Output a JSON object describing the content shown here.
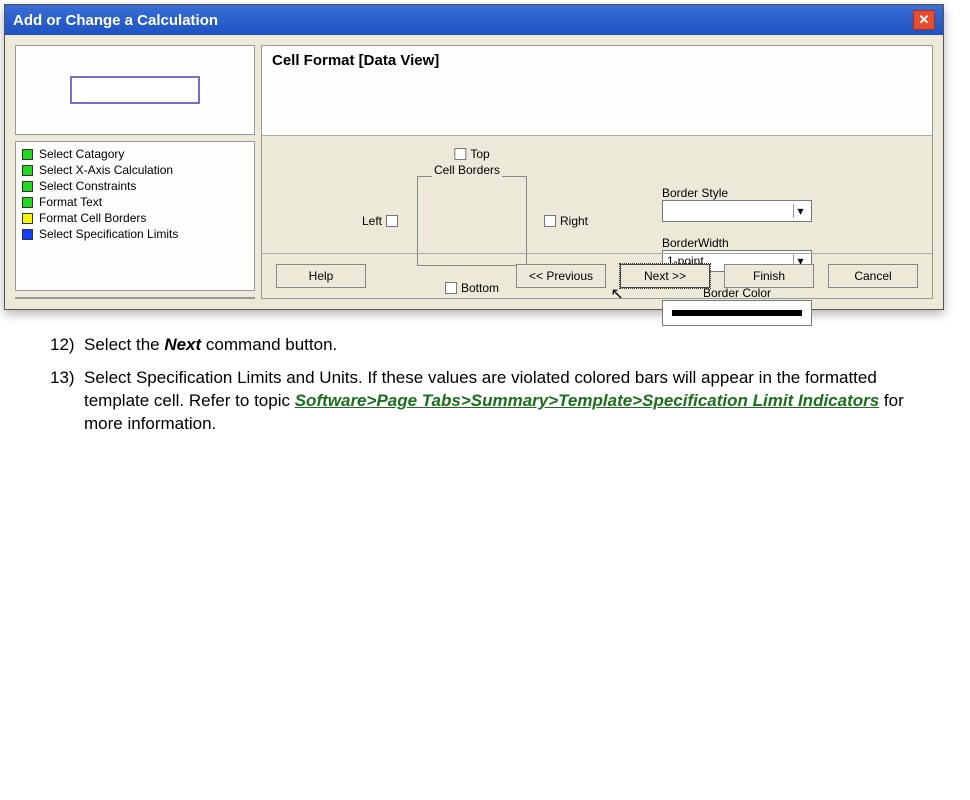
{
  "window_title": "Add or Change a Calculation",
  "panel_heading": "Cell Format [Data View]",
  "steps": [
    {
      "color": "green",
      "label": "Select Catagory"
    },
    {
      "color": "green",
      "label": "Select X-Axis Calculation"
    },
    {
      "color": "green",
      "label": "Select Constraints"
    },
    {
      "color": "green",
      "label": "Format Text"
    },
    {
      "color": "yellow",
      "label": "Format Cell Borders"
    },
    {
      "color": "blue",
      "label": "Select Specification Limits"
    }
  ],
  "borders": {
    "group_label": "Cell Borders",
    "top": "Top",
    "bottom": "Bottom",
    "left": "Left",
    "right": "Right"
  },
  "controls": {
    "style_label": "Border Style",
    "style_value": "",
    "width_label": "BorderWidth",
    "width_value": "1-point",
    "color_label": "Border Color"
  },
  "buttons": {
    "help": "Help",
    "previous": "<< Previous",
    "next": "Next >>",
    "finish": "Finish",
    "cancel": "Cancel"
  },
  "doc": {
    "item12_num": "12)",
    "item12_a": "Select the ",
    "item12_b": "Next",
    "item12_c": " command button.",
    "item13_num": "13)",
    "item13_a": "Select Specification Limits and Units. If these values are violated colored bars will appear in the formatted template cell. Refer to   topic ",
    "item13_link": "Software>Page Tabs>Summary>Template>Specification Limit Indicators",
    "item13_c": " for more information."
  }
}
